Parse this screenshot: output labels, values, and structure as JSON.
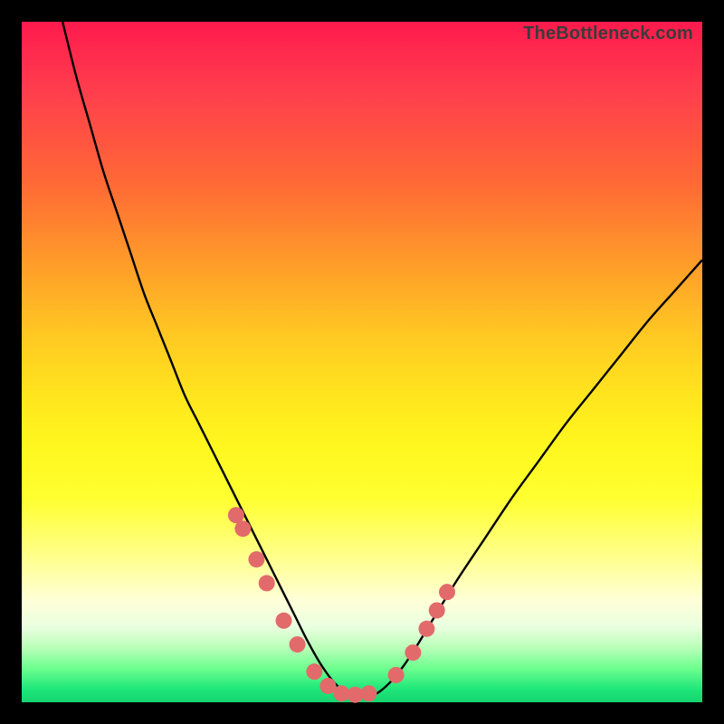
{
  "watermark": "TheBottleneck.com",
  "colors": {
    "background": "#000000",
    "curve_stroke": "#000000",
    "marker_fill": "#e36a6a",
    "marker_stroke": "#c94f4f"
  },
  "chart_data": {
    "type": "line",
    "title": "",
    "xlabel": "",
    "ylabel": "",
    "xlim": [
      0,
      100
    ],
    "ylim": [
      0,
      100
    ],
    "grid": false,
    "legend": false,
    "series": [
      {
        "name": "bottleneck-curve",
        "x": [
          6,
          8,
          10,
          12,
          14,
          16,
          18,
          20,
          22,
          24,
          26,
          28,
          30,
          32,
          34,
          36,
          38,
          40,
          42,
          44,
          46,
          48,
          50,
          52,
          54,
          56,
          58,
          60,
          64,
          68,
          72,
          76,
          80,
          84,
          88,
          92,
          96,
          100
        ],
        "y": [
          100,
          92,
          85,
          78,
          72,
          66,
          60,
          55,
          50,
          45,
          41,
          37,
          33,
          29,
          25,
          21,
          17,
          13,
          9,
          5.5,
          2.8,
          1.2,
          0.7,
          1.2,
          2.8,
          5.2,
          8.2,
          11.5,
          18,
          24,
          30,
          35.5,
          41,
          46,
          51,
          56,
          60.5,
          65
        ]
      }
    ],
    "markers": {
      "name": "highlight-points",
      "x": [
        31.5,
        32.5,
        34.5,
        36,
        38.5,
        40.5,
        43,
        45,
        47,
        49,
        51,
        55,
        57.5,
        59.5,
        61,
        62.5
      ],
      "y": [
        27.5,
        25.5,
        21,
        17.5,
        12,
        8.5,
        4.5,
        2.4,
        1.3,
        1.1,
        1.3,
        4,
        7.3,
        10.8,
        13.5,
        16.2
      ]
    }
  }
}
